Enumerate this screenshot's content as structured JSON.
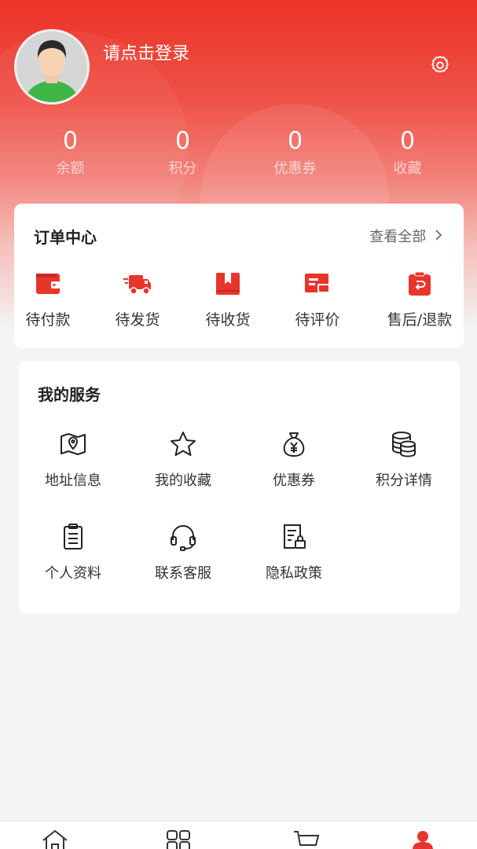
{
  "profile": {
    "login_prompt": "请点击登录",
    "avatar_icon": "default-avatar",
    "settings_icon": "gear-icon"
  },
  "stats": [
    {
      "value": "0",
      "label": "余额"
    },
    {
      "value": "0",
      "label": "积分"
    },
    {
      "value": "0",
      "label": "优惠券"
    },
    {
      "value": "0",
      "label": "收藏"
    }
  ],
  "orders": {
    "title": "订单中心",
    "view_all": "查看全部",
    "items": [
      {
        "label": "待付款",
        "icon": "wallet-icon"
      },
      {
        "label": "待发货",
        "icon": "delivery-truck-icon"
      },
      {
        "label": "待收货",
        "icon": "package-box-icon"
      },
      {
        "label": "待评价",
        "icon": "review-card-icon"
      },
      {
        "label": "售后/退款",
        "icon": "refund-bag-icon"
      }
    ]
  },
  "services": {
    "title": "我的服务",
    "items": [
      {
        "label": "地址信息",
        "icon": "map-pin-icon"
      },
      {
        "label": "我的收藏",
        "icon": "star-icon"
      },
      {
        "label": "优惠券",
        "icon": "money-bag-icon"
      },
      {
        "label": "积分详情",
        "icon": "coin-stack-icon"
      },
      {
        "label": "个人资料",
        "icon": "clipboard-icon"
      },
      {
        "label": "联系客服",
        "icon": "headset-icon"
      },
      {
        "label": "隐私政策",
        "icon": "document-lock-icon"
      }
    ]
  },
  "tabbar": {
    "tabs": [
      {
        "icon": "home-icon",
        "active": false
      },
      {
        "icon": "category-grid-icon",
        "active": false
      },
      {
        "icon": "cart-icon",
        "active": false
      },
      {
        "icon": "user-icon",
        "active": true
      }
    ]
  },
  "colors": {
    "accent": "#e8352c",
    "header_top": "#ec3327",
    "background": "#f4f4f4"
  }
}
